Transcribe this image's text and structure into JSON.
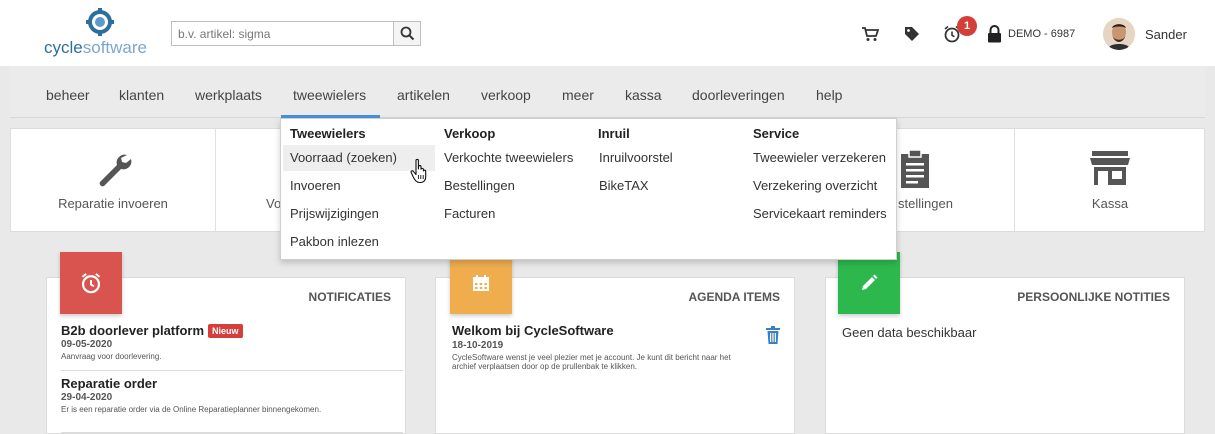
{
  "header": {
    "logo": {
      "brand_bold": "cycle",
      "brand_light": "software"
    },
    "search": {
      "placeholder": "b.v. artikel: sigma"
    },
    "icons": [
      "cart-icon",
      "tag-icon",
      "alarm-icon",
      "lock-icon"
    ],
    "notification_count": "1",
    "account": "DEMO - 6987",
    "user_name": "Sander"
  },
  "nav": {
    "items": [
      "beheer",
      "klanten",
      "werkplaats",
      "tweewielers",
      "artikelen",
      "verkoop",
      "meer",
      "kassa",
      "doorleveringen",
      "help"
    ],
    "active": "tweewielers"
  },
  "tiles": [
    {
      "label": "Reparatie invoeren",
      "icon": "wrench-icon"
    },
    {
      "label": "Vo",
      "icon": ""
    },
    {
      "label": "stellingen",
      "icon": "clipboard-icon"
    },
    {
      "label": "Kassa",
      "icon": "store-icon"
    }
  ],
  "dropdown": {
    "columns": [
      {
        "title": "Tweewielers",
        "items": [
          "Voorraad (zoeken)",
          "Invoeren",
          "Prijswijzigingen",
          "Pakbon inlezen"
        ]
      },
      {
        "title": "Verkoop",
        "items": [
          "Verkochte tweewielers",
          "Bestellingen",
          "Facturen"
        ]
      },
      {
        "title": "Inruil",
        "items": [
          "Inruilvoorstel",
          "BikeTAX"
        ]
      },
      {
        "title": "Service",
        "items": [
          "Tweewieler verzekeren",
          "Verzekering overzicht",
          "Servicekaart reminders"
        ]
      }
    ],
    "hovered": "Voorraad (zoeken)"
  },
  "cards": {
    "notifications": {
      "title": "NOTIFICATIES",
      "color": "#d9534f",
      "items": [
        {
          "title": "B2b doorlever platform",
          "badge": "Nieuw",
          "date": "09-05-2020",
          "desc": "Aanvraag voor doorlevering."
        },
        {
          "title": "Reparatie order",
          "badge": "",
          "date": "29-04-2020",
          "desc": "Er is een reparatie order via de Online Reparatieplanner binnengekomen."
        }
      ]
    },
    "agenda": {
      "title": "AGENDA ITEMS",
      "color": "#f0ad4e",
      "item": {
        "title": "Welkom bij CycleSoftware",
        "date": "18-10-2019",
        "desc": "CycleSoftware wenst je veel plezier met je account. Je kunt dit bericht naar het archief verplaatsen door op de prullenbak te klikken."
      }
    },
    "notes": {
      "title": "PERSOONLIJKE NOTITIES",
      "color": "#2db84d",
      "empty": "Geen data beschikbaar"
    }
  }
}
